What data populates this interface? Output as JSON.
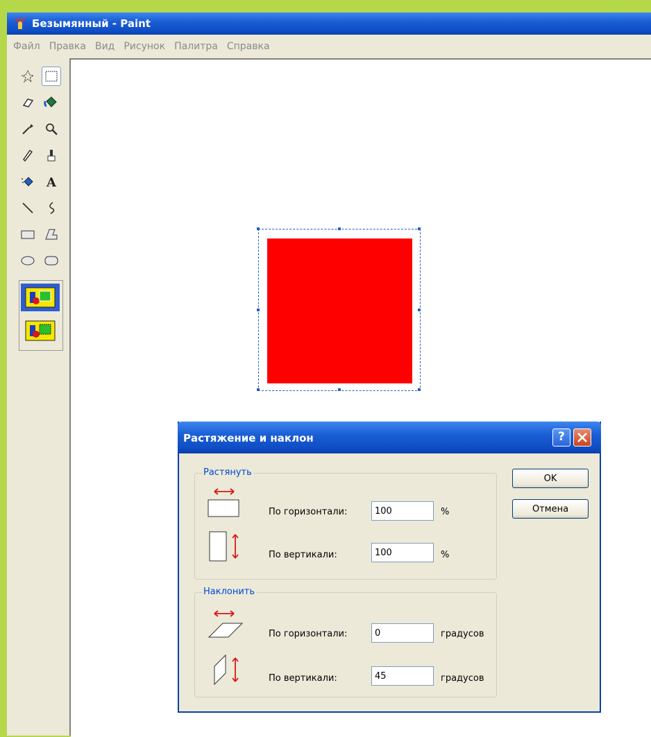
{
  "window": {
    "title": "Безымянный - Paint"
  },
  "menu": [
    "Файл",
    "Правка",
    "Вид",
    "Рисунок",
    "Палитра",
    "Справка"
  ],
  "tools": [
    "free-select",
    "rect-select",
    "eraser",
    "fill",
    "color-picker",
    "magnifier",
    "pencil",
    "brush",
    "airbrush",
    "text",
    "line",
    "curve",
    "rectangle",
    "polygon",
    "ellipse",
    "rounded-rect"
  ],
  "colors": {
    "title_bar": "#0e4cc4",
    "shape_fill": "#ff0000",
    "group_label": "#0046d5"
  },
  "dialog": {
    "title": "Растяжение и наклон",
    "help_button": "?",
    "ok_label": "OK",
    "cancel_label": "Отмена",
    "stretch": {
      "label": "Растянуть",
      "horizontal_label": "По горизонтали:",
      "horizontal_value": "100",
      "horizontal_unit": "%",
      "vertical_label": "По вертикали:",
      "vertical_value": "100",
      "vertical_unit": "%"
    },
    "skew": {
      "label": "Наклонить",
      "horizontal_label": "По горизонтали:",
      "horizontal_value": "0",
      "horizontal_unit": "градусов",
      "vertical_label": "По вертикали:",
      "vertical_value": "45",
      "vertical_unit": "градусов"
    }
  }
}
